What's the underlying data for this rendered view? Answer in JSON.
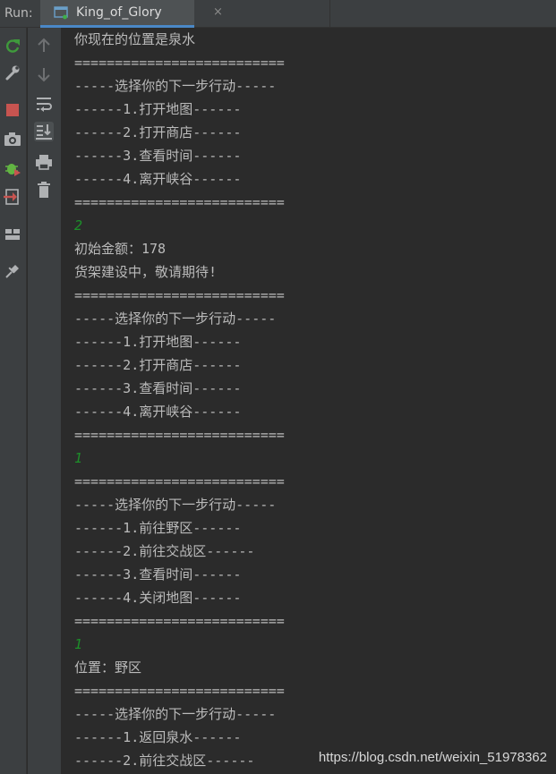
{
  "toolwindow": {
    "run_label": "Run:",
    "tab_title": "King_of_Glory",
    "tab_close": "×"
  },
  "toolbar_left": [
    {
      "name": "rerun-icon",
      "color": "#3f9a3c"
    },
    {
      "name": "wrench-icon",
      "color": "#afb1b3"
    },
    {
      "name": "stop-icon",
      "color": "#c75450"
    },
    {
      "name": "camera-icon",
      "color": "#afb1b3"
    },
    {
      "name": "debug-bug-icon",
      "color": "#62b543"
    },
    {
      "name": "exit-icon",
      "color": "#c75450"
    },
    {
      "name": "layout-icon",
      "color": "#afb1b3"
    },
    {
      "name": "pin-icon",
      "color": "#afb1b3"
    }
  ],
  "toolbar_mid": [
    {
      "name": "up-arrow-icon"
    },
    {
      "name": "down-arrow-icon"
    },
    {
      "name": "soft-wrap-icon"
    },
    {
      "name": "scroll-to-end-icon"
    },
    {
      "name": "print-icon"
    },
    {
      "name": "trash-icon"
    }
  ],
  "console": {
    "lines": [
      {
        "text": "你现在的位置是泉水",
        "type": "output"
      },
      {
        "text": "==========================",
        "type": "output"
      },
      {
        "text": "-----选择你的下一步行动-----",
        "type": "output"
      },
      {
        "text": "------1.打开地图------",
        "type": "output"
      },
      {
        "text": "------2.打开商店------",
        "type": "output"
      },
      {
        "text": "------3.查看时间------",
        "type": "output"
      },
      {
        "text": "------4.离开峡谷------",
        "type": "output"
      },
      {
        "text": "==========================",
        "type": "output"
      },
      {
        "text": "2",
        "type": "input"
      },
      {
        "text": "初始金额：178",
        "type": "output"
      },
      {
        "text": "货架建设中，敬请期待!",
        "type": "output"
      },
      {
        "text": "==========================",
        "type": "output"
      },
      {
        "text": "-----选择你的下一步行动-----",
        "type": "output"
      },
      {
        "text": "------1.打开地图------",
        "type": "output"
      },
      {
        "text": "------2.打开商店------",
        "type": "output"
      },
      {
        "text": "------3.查看时间------",
        "type": "output"
      },
      {
        "text": "------4.离开峡谷------",
        "type": "output"
      },
      {
        "text": "==========================",
        "type": "output"
      },
      {
        "text": "1",
        "type": "input"
      },
      {
        "text": "==========================",
        "type": "output"
      },
      {
        "text": "-----选择你的下一步行动-----",
        "type": "output"
      },
      {
        "text": "------1.前往野区------",
        "type": "output"
      },
      {
        "text": "------2.前往交战区------",
        "type": "output"
      },
      {
        "text": "------3.查看时间------",
        "type": "output"
      },
      {
        "text": "------4.关闭地图------",
        "type": "output"
      },
      {
        "text": "==========================",
        "type": "output"
      },
      {
        "text": "1",
        "type": "input"
      },
      {
        "text": "位置：野区",
        "type": "output"
      },
      {
        "text": "==========================",
        "type": "output"
      },
      {
        "text": "-----选择你的下一步行动-----",
        "type": "output"
      },
      {
        "text": "------1.返回泉水------",
        "type": "output"
      },
      {
        "text": "------2.前往交战区------",
        "type": "output"
      }
    ]
  },
  "watermark": "https://blog.csdn.net/weixin_51978362",
  "colors": {
    "background": "#2b2b2b",
    "panel": "#3c3f41",
    "text": "#bbbbbb",
    "user_input": "#1d8f2a",
    "tab_accent": "#4a88c7"
  }
}
